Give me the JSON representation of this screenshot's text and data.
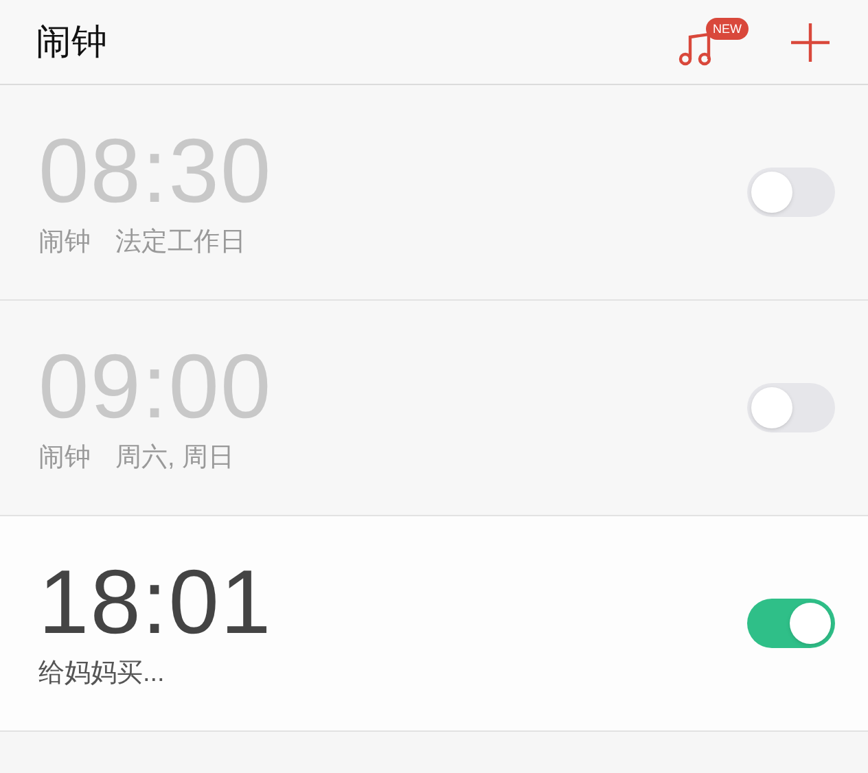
{
  "header": {
    "title": "闹钟",
    "badge": "NEW"
  },
  "alarms": [
    {
      "time": "08:30",
      "label": "闹钟",
      "repeat": "法定工作日",
      "on": false
    },
    {
      "time": "09:00",
      "label": "闹钟",
      "repeat": "周六, 周日",
      "on": false
    },
    {
      "time": "18:01",
      "label": "给妈妈买...",
      "on": true
    }
  ]
}
